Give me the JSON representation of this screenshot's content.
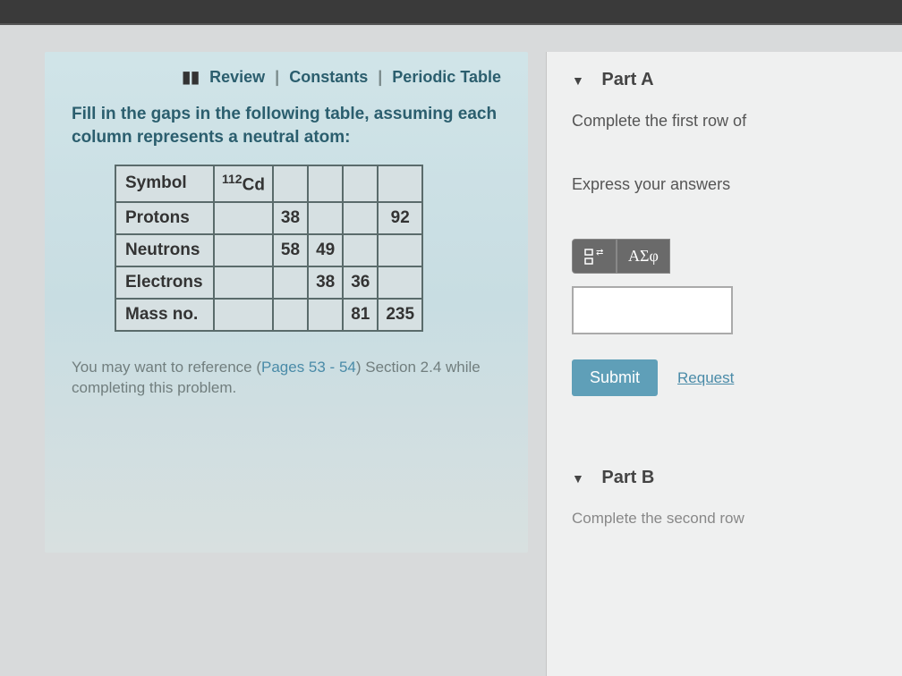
{
  "links": {
    "review": "Review",
    "constants": "Constants",
    "periodic": "Periodic Table"
  },
  "instruction": "Fill in the gaps in the following table, assuming each column represents a neutral atom:",
  "table": {
    "rows": [
      {
        "label": "Symbol",
        "c1_pre": "112",
        "c1": "Cd",
        "c2": "",
        "c3": "",
        "c4": "",
        "c5": ""
      },
      {
        "label": "Protons",
        "c1": "",
        "c2": "38",
        "c3": "",
        "c4": "",
        "c5": "92"
      },
      {
        "label": "Neutrons",
        "c1": "",
        "c2": "58",
        "c3": "49",
        "c4": "",
        "c5": ""
      },
      {
        "label": "Electrons",
        "c1": "",
        "c2": "",
        "c3": "38",
        "c4": "36",
        "c5": ""
      },
      {
        "label": "Mass no.",
        "c1": "",
        "c2": "",
        "c3": "",
        "c4": "81",
        "c5": "235"
      }
    ]
  },
  "reference": {
    "prefix": "You may want to reference (",
    "link": "Pages 53 - 54",
    "suffix": ") Section 2.4 while completing this problem."
  },
  "partA": {
    "title": "Part A",
    "subtitle": "Complete the first row of",
    "express": "Express your answers",
    "toolbar_sigma": "ΑΣφ",
    "submit": "Submit",
    "request": "Request"
  },
  "partB": {
    "title": "Part B",
    "subtitle": "Complete the second row"
  }
}
